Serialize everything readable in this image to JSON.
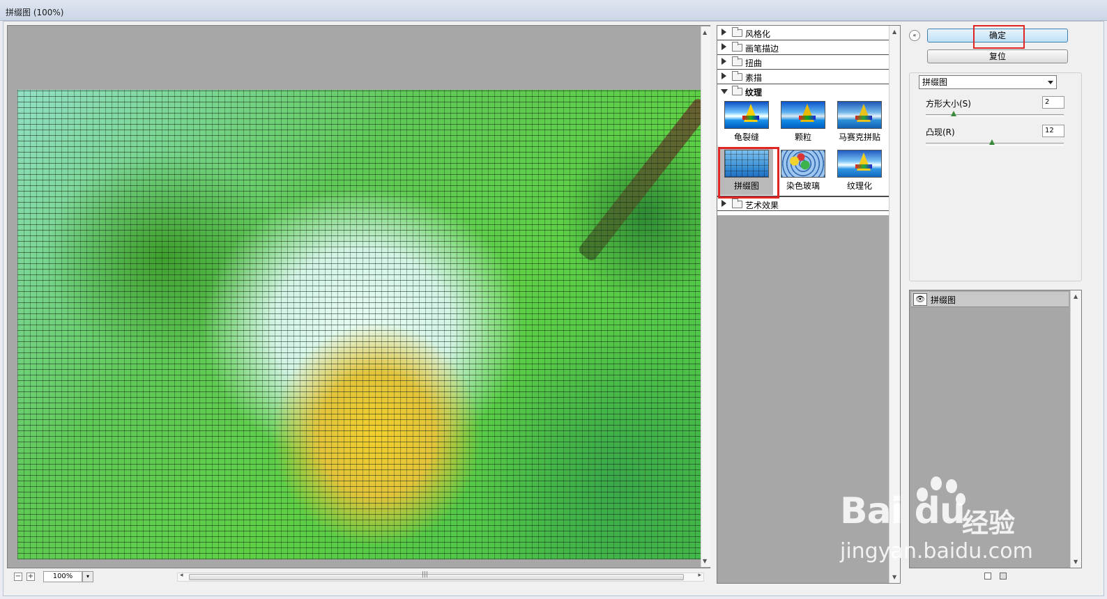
{
  "window": {
    "title": "拼缀图 (100%)"
  },
  "preview": {
    "zoom": "100%",
    "zoom_out": "−",
    "zoom_in": "+",
    "zoom_caret": "▾",
    "scroll_up": "▲",
    "scroll_down": "▼",
    "scroll_left": "◂",
    "scroll_right": "▸",
    "grip": "|||"
  },
  "filters": {
    "categories": [
      {
        "label": "风格化"
      },
      {
        "label": "画笔描边"
      },
      {
        "label": "扭曲"
      },
      {
        "label": "素描"
      },
      {
        "label": "纹理",
        "expanded": true
      },
      {
        "label": "艺术效果"
      }
    ],
    "texture_items": [
      "龟裂缝",
      "颗粒",
      "马赛克拼贴",
      "拼缀图",
      "染色玻璃",
      "纹理化"
    ],
    "selected": "拼缀图"
  },
  "buttons": {
    "ok": "确定",
    "reset": "复位",
    "collapse": "«"
  },
  "settings": {
    "filter_select": "拼缀图",
    "params": [
      {
        "label": "方形大小(S)",
        "value": "2",
        "fraction": 0.2
      },
      {
        "label": "凸现(R)",
        "value": "12",
        "fraction": 0.48
      }
    ]
  },
  "layers": {
    "items": [
      {
        "label": "拼缀图",
        "eye": "👁"
      }
    ]
  },
  "watermark": {
    "brand": "Bai du",
    "cn": "经验",
    "url": "jingyan.baidu.com"
  },
  "colors": {
    "highlight": "#e02424",
    "panel_gray": "#a7a7a7"
  }
}
